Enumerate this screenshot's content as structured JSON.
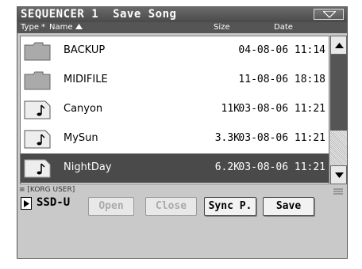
{
  "window": {
    "title": "SEQUENCER 1  Save Song"
  },
  "columns": {
    "type": "Type",
    "star": "*",
    "name": "Name",
    "size": "Size",
    "date": "Date"
  },
  "files": [
    {
      "kind": "folder",
      "name": "BACKUP",
      "size": "",
      "date": "04-08-06 11:14"
    },
    {
      "kind": "folder",
      "name": "MIDIFILE",
      "size": "",
      "date": "11-08-06 18:18"
    },
    {
      "kind": "song",
      "name": "Canyon",
      "size": "11K",
      "date": "03-08-06 11:21"
    },
    {
      "kind": "song",
      "name": "MySun",
      "size": "3.3K",
      "date": "03-08-06 11:21"
    },
    {
      "kind": "song",
      "name": "NightDay",
      "size": "6.2K",
      "date": "03-08-06 11:21",
      "selected": true
    }
  ],
  "footer": {
    "device_label": "[KORG USER]",
    "device_name": "SSD-U",
    "open_label": "Open",
    "close_label": "Close",
    "sync_label": "Sync P.",
    "save_label": "Save"
  },
  "icons": {
    "folder": "folder-icon",
    "song": "music-note-file-icon",
    "scroll_up": "arrow-up-icon",
    "scroll_down": "arrow-down-icon",
    "dropdown": "chevron-down-icon",
    "device": "play-triangle-icon"
  },
  "colors": {
    "title_bg": "#555555",
    "selected_row": "#4a4a4a",
    "panel": "#c9c9c9"
  }
}
